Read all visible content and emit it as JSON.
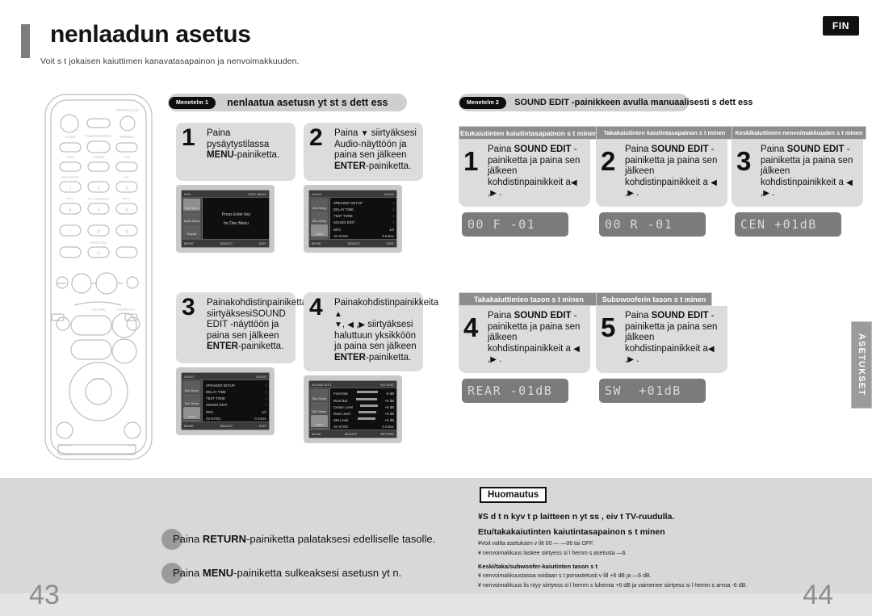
{
  "header": {
    "title": "nenlaadun asetus",
    "subtitle": "Voit s  t  jokaisen kaiuttimen kanavatasapainon ja  nenvoimakkuuden.",
    "lang_badge": "FIN"
  },
  "side_tab": {
    "label": "ASETUKSET"
  },
  "left_panel": {
    "pill": {
      "tag": "Menetelm  1",
      "title": "nenlaatua asetusn yt st  s  dett ess"
    },
    "steps": [
      {
        "num": "1",
        "text_parts": [
          "Paina pysäytystilassa ",
          "MENU",
          "-painiketta."
        ],
        "screen": {
          "top_left": "DVD",
          "top_right": "DISC MENU",
          "menu_items": [
            "Disc Menu",
            "Audio Setup",
            "Display",
            "Setup"
          ],
          "selected_index": 0,
          "body_lines": [
            "Press Enter key",
            "for Disc Menu"
          ],
          "bottom_left": "MOVE",
          "bottom_mid": "SELECT",
          "bottom_right": "EXIT"
        }
      },
      {
        "num": "2",
        "text_parts": [
          "Paina ▼ siirtyäksesi Audio-näyttöön ja paina sen jälkeen ",
          "ENTER",
          "-painiketta."
        ],
        "screen": {
          "top_left": "AUDIO",
          "top_right": "AUDIO",
          "menu_items": [
            "Disc Setup",
            "Disc Setup",
            "Audio",
            "Setup"
          ],
          "selected_index": 2,
          "rows": [
            {
              "label": "SPEAKER SETUP",
              "value": "›"
            },
            {
              "label": "DELAY TIME",
              "value": "›"
            },
            {
              "label": "TEST TONE",
              "value": "›"
            },
            {
              "label": "SOUND EDIT",
              "value": "›"
            },
            {
              "label": "DRC",
              "value": "1/2"
            },
            {
              "label": "AV-SYNC",
              "value": "0 mSec"
            }
          ],
          "bottom_left": "MOVE",
          "bottom_mid": "SELECT",
          "bottom_right": "EXIT"
        }
      },
      {
        "num": "3",
        "text_parts": [
          "Painakohdistinpainiketta▼ siirtyäksesiSOUND EDIT -näyttöön ja paina sen jälkeen ",
          "ENTER",
          "-painiketta."
        ],
        "screen": {
          "top_left": "AUDIO",
          "top_right": "AUDIO",
          "menu_items": [
            "Disc Setup",
            "Disc Setup",
            "Audio",
            "Setup"
          ],
          "selected_index": 2,
          "rows": [
            {
              "label": "SPEAKER SETUP",
              "value": "›"
            },
            {
              "label": "DELAY TIME",
              "value": "›"
            },
            {
              "label": "TEST TONE",
              "value": "›"
            },
            {
              "label": "SOUND EDIT",
              "value": "›"
            },
            {
              "label": "DRC",
              "value": "1/2"
            },
            {
              "label": "AV-SYNC",
              "value": "0 mSec"
            }
          ],
          "bottom_left": "MOVE",
          "bottom_mid": "SELECT",
          "bottom_right": "EXIT"
        }
      },
      {
        "num": "4",
        "text_parts": [
          "Painakohdistinpainikkeita ▲ ▼, ◀ , ▶ siirtyäksesi haluttuun yksikköön ja paina sen jälkeen ",
          "ENTER",
          "-painiketta."
        ],
        "screen": {
          "top_left": "SOUND EDIT",
          "top_right": "NO DISC",
          "menu_items": [
            "Disc Setup",
            "Disc Setup",
            "Audio",
            "Setup"
          ],
          "selected_index": 2,
          "rows": [
            {
              "label": "Front Bal.",
              "value": "-6 dB"
            },
            {
              "label": "Rear Bal.",
              "value": "+6 dB"
            },
            {
              "label": "Center Level",
              "value": "+6 dB"
            },
            {
              "label": "Rear Level",
              "value": "+6 dB"
            },
            {
              "label": "SW Level",
              "value": "+6 dB"
            },
            {
              "label": "AV-SYNC",
              "value": "0 mSec"
            }
          ],
          "bottom_left": "MOVE",
          "bottom_mid": "ADJUST",
          "bottom_right": "RETURN"
        }
      }
    ]
  },
  "right_panel": {
    "pill": {
      "tag": "Menetelm  2",
      "title": "SOUND EDIT -painikkeen avulla manuaalisesti s  dett ess"
    },
    "row1_tabs": [
      "Etukaiutinten kaiutintasapainon s  t  minen",
      "Takakaiutinten kaiutintasapainon s  t  minen",
      "Keskikaiuttimen   nenvoimakkuuden s  t  minen"
    ],
    "row1_steps": [
      {
        "num": "1",
        "text_parts": [
          "Paina ",
          "SOUND EDIT",
          " -painiketta ja paina sen jälkeen kohdistinpainikkeit a◀ , ▶ ."
        ],
        "lcd": "00 F -01"
      },
      {
        "num": "2",
        "text_parts": [
          "Paina ",
          "SOUND EDIT",
          " -painiketta ja paina sen jälkeen kohdistinpainikkeit a ◀ , ▶ ."
        ],
        "lcd": "00 R -01"
      },
      {
        "num": "3",
        "text_parts": [
          "Paina ",
          "SOUND EDIT",
          " -painiketta ja paina sen jälkeen kohdistinpainikkeit a ◀ , ▶ ."
        ],
        "lcd": "CEN +01dB"
      }
    ],
    "row2_tabs": [
      "Takakaiuttimien tason s  t  minen",
      "Subowooferin tason s  t  minen"
    ],
    "row2_steps": [
      {
        "num": "4",
        "text_parts": [
          "Paina ",
          "SOUND EDIT",
          " -painiketta ja paina sen jälkeen kohdistinpainikkeit a ◀ , ▶ ."
        ],
        "lcd": "REAR -01dB"
      },
      {
        "num": "5",
        "text_parts": [
          "Paina ",
          "SOUND EDIT",
          " -painiketta ja paina sen jälkeen kohdistinpainikkeit a◀ , ▶ ."
        ],
        "lcd": "SW  +01dB"
      }
    ]
  },
  "bottom_instructions": [
    {
      "parts": [
        "Paina ",
        "RETURN",
        "-painiketta palataksesi edelliselle tasolle."
      ]
    },
    {
      "parts": [
        "Paina ",
        "MENU",
        "-painiketta sulkeaksesi asetusn yt n."
      ]
    }
  ],
  "note": {
    "badge": "Huomautus",
    "line1": "¥S  d t n kyv t p  laitteen n yt ss , eiv t TV-ruudulla.",
    "head1": "Etu/takakaiutinten kaiutintasapainon s  t  minen",
    "bullet1": "¥Voit valita asetuksen v lilt  00 —  —06 tai OFF.",
    "bullet2": "¥  nenvoimakkuus laskee siirtyess  si l hemm s asetusta —6.",
    "head2": "Keski/taka/subwoofer-kaiutinten tason s  t",
    "bullet3": "¥  nenvoimakkuustasoa voidaan s  t   porrastetusti v lill  +6 dB ja —6 dB.",
    "bullet4": "¥  nenvoimakkuus lis  ntyy siirtyess  si l hemm s lukemia +6 dB ja vaimenee siirtyess  si l hemm s arvoa -6 dB."
  },
  "page_numbers": {
    "left": "43",
    "right": "44"
  }
}
